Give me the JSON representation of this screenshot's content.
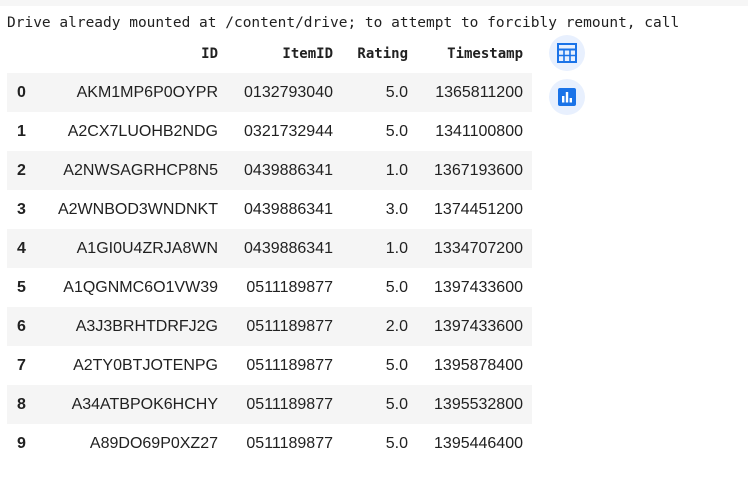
{
  "output": {
    "message": "Drive already mounted at /content/drive; to attempt to forcibly remount, call"
  },
  "table": {
    "columns": [
      "ID",
      "ItemID",
      "Rating",
      "Timestamp"
    ],
    "rows": [
      {
        "index": "0",
        "id": "AKM1MP6P0OYPR",
        "item_id": "0132793040",
        "rating": "5.0",
        "timestamp": "1365811200"
      },
      {
        "index": "1",
        "id": "A2CX7LUOHB2NDG",
        "item_id": "0321732944",
        "rating": "5.0",
        "timestamp": "1341100800"
      },
      {
        "index": "2",
        "id": "A2NWSAGRHCP8N5",
        "item_id": "0439886341",
        "rating": "1.0",
        "timestamp": "1367193600"
      },
      {
        "index": "3",
        "id": "A2WNBOD3WNDNKT",
        "item_id": "0439886341",
        "rating": "3.0",
        "timestamp": "1374451200"
      },
      {
        "index": "4",
        "id": "A1GI0U4ZRJA8WN",
        "item_id": "0439886341",
        "rating": "1.0",
        "timestamp": "1334707200"
      },
      {
        "index": "5",
        "id": "A1QGNMC6O1VW39",
        "item_id": "0511189877",
        "rating": "5.0",
        "timestamp": "1397433600"
      },
      {
        "index": "6",
        "id": "A3J3BRHTDRFJ2G",
        "item_id": "0511189877",
        "rating": "2.0",
        "timestamp": "1397433600"
      },
      {
        "index": "7",
        "id": "A2TY0BTJOTENPG",
        "item_id": "0511189877",
        "rating": "5.0",
        "timestamp": "1395878400"
      },
      {
        "index": "8",
        "id": "A34ATBPOK6HCHY",
        "item_id": "0511189877",
        "rating": "5.0",
        "timestamp": "1395532800"
      },
      {
        "index": "9",
        "id": "A89DO69P0XZ27",
        "item_id": "0511189877",
        "rating": "5.0",
        "timestamp": "1395446400"
      }
    ]
  },
  "actions": {
    "interactive_table_icon": "table-icon",
    "chart_suggestion_icon": "bar-chart-icon",
    "icon_color": "#1a73e8",
    "button_bg": "#e8f0fe"
  }
}
